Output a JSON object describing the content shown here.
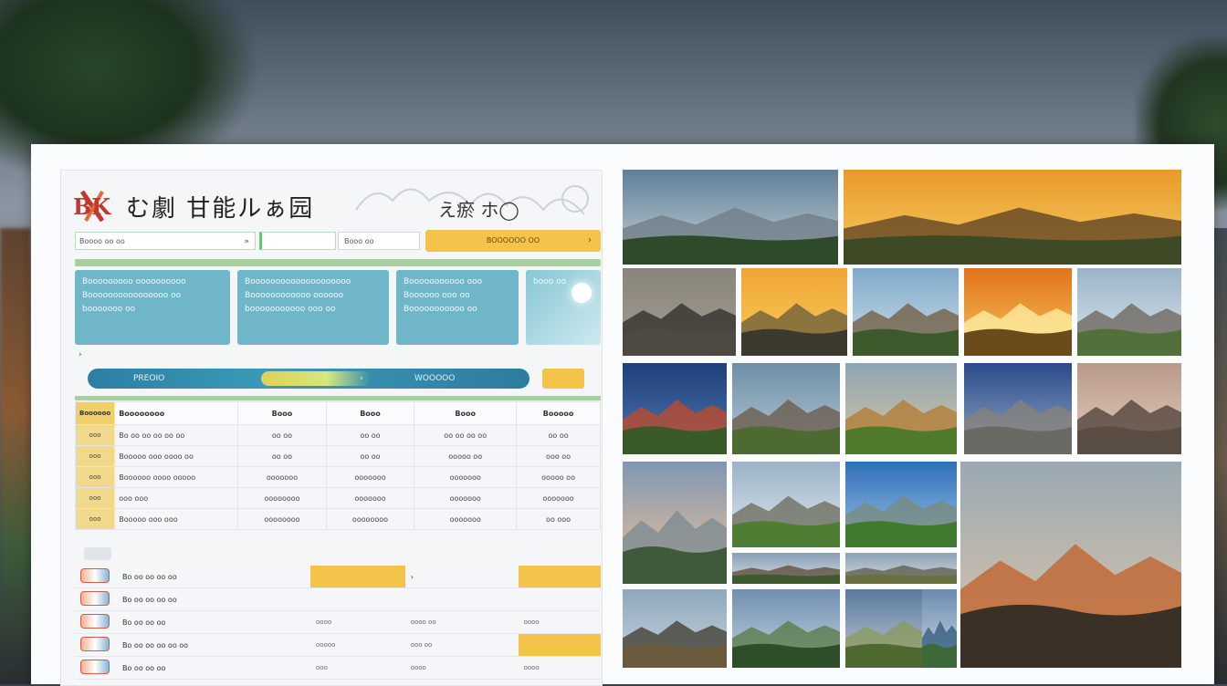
{
  "app": {
    "logo_text": "BK",
    "title": "む劇 甘能ルぁ园",
    "title_ext": "え瘀 ホ◯"
  },
  "search": {
    "placeholder": "Boooo oo oo",
    "arrow": "»"
  },
  "field3": {
    "text": "Booo oo"
  },
  "cta": {
    "label": "BOOOOOO OO",
    "arrow": "›"
  },
  "cards": [
    {
      "lines": [
        "Booooooooo oooooooooo",
        "Boooooooooooooooo oo",
        "booooooo oo"
      ]
    },
    {
      "lines": [
        "Boooooooooooooooooooo",
        "Boooooooooooo oooooo",
        "booooooooooo ooo oo"
      ]
    },
    {
      "lines": [
        "Booooooooooo ooo",
        "Boooooo ooo oo",
        "Booooooooooo oo"
      ]
    },
    {
      "lines": [
        "",
        "",
        "booo oo"
      ]
    }
  ],
  "tick": "›",
  "banner": {
    "left": "PREOIO",
    "mid": "›",
    "right": "WOOOOO"
  },
  "table": {
    "header": [
      "Boooooo",
      "Boooooooo",
      "Booo",
      "Booo",
      "Booo",
      "Booooo"
    ],
    "rows": [
      [
        "ooo",
        "Bo oo oo oo oo oo",
        "oo oo",
        "oo oo",
        "oo oo oo oo",
        "oo oo"
      ],
      [
        "ooo",
        "Booooo ooo oooo oo",
        "oo oo",
        "oo oo",
        "ooooo oo",
        "ooo oo"
      ],
      [
        "ooo",
        "Boooooo oooo ooooo",
        "ooooooo",
        "ooooooo",
        "ooooooo",
        "ooooo oo"
      ],
      [
        "ooo",
        "ooo  ooo",
        "oooooooo",
        "ooooooo",
        "ooooooo",
        "ooooooo"
      ],
      [
        "ooo",
        "Booooo ooo  ooo",
        "oooooooo",
        "oooooooo",
        "ooooooo",
        "oo ooo"
      ]
    ]
  },
  "list": {
    "rows": [
      {
        "name": "Bo oo oo oo oo",
        "c2": "",
        "c3": "›",
        "c4": ""
      },
      {
        "name": "Bo oo oo oo oo",
        "c2": "",
        "c3": "",
        "c4": ""
      },
      {
        "name": "Bo oo oo oo",
        "c2": "oooo",
        "c3": "oooo oo",
        "c4": "oooo"
      },
      {
        "name": "Bo oo oo oo oo oo",
        "c2": "ooooo",
        "c3": "ooo oo",
        "c4": ""
      },
      {
        "name": "Bo oo oo oo",
        "c2": "ooo",
        "c3": "oooo",
        "c4": "oooo"
      }
    ]
  },
  "gallery": [
    {
      "name": "mountain-forest-photo",
      "sky": "#5f7f98",
      "sky2": "#c9d2d6",
      "land": "#2e4a2a",
      "accent": "#6e7b83"
    },
    {
      "name": "temple-sunset-photo",
      "sky": "#e89a2a",
      "sky2": "#f6cc62",
      "land": "#3d4a25",
      "accent": "#5a3e22"
    },
    {
      "name": "stone-temple-photo",
      "sky": "#8a857c",
      "sky2": "#a39d90",
      "land": "#4e4a42",
      "accent": "#2e2b27"
    },
    {
      "name": "golden-clouds-photo",
      "sky": "#f0a436",
      "sky2": "#f8cf5a",
      "land": "#3b3a2c",
      "accent": "#6a5a3a"
    },
    {
      "name": "big-tree-photo",
      "sky": "#7fa9c9",
      "sky2": "#cfe0ea",
      "land": "#3e5a2c",
      "accent": "#6f5a3d"
    },
    {
      "name": "sun-hill-photo",
      "sky": "#e0731c",
      "sky2": "#f9c35a",
      "land": "#6b4a1c",
      "accent": "#fff1a8"
    },
    {
      "name": "domed-ruins-photo",
      "sky": "#9ab4c8",
      "sky2": "#dde6ea",
      "land": "#52703a",
      "accent": "#6a6258"
    },
    {
      "name": "pagoda-night-photo",
      "sky": "#1e3f7a",
      "sky2": "#4f78b0",
      "land": "#3a5a2a",
      "accent": "#c34a24"
    },
    {
      "name": "castle-tower-photo",
      "sky": "#6d8fa6",
      "sky2": "#b8cad6",
      "land": "#4d6a32",
      "accent": "#6a584a"
    },
    {
      "name": "golden-spires-photo",
      "sky": "#8ea3b4",
      "sky2": "#d8c8a0",
      "land": "#4f7a2c",
      "accent": "#b07a30"
    },
    {
      "name": "gothic-town-photo",
      "sky": "#2a4a8a",
      "sky2": "#93a9c6",
      "land": "#6a6a64",
      "accent": "#8a8278"
    },
    {
      "name": "cathedral-dusk-photo",
      "sky": "#b89a8a",
      "sky2": "#e6cdbb",
      "land": "#5a4e44",
      "accent": "#4a3e36"
    },
    {
      "name": "valley-sunset-photo",
      "sky": "#7f97b2",
      "sky2": "#f1c49a",
      "land": "#3e5a3a",
      "accent": "#7a8a92"
    },
    {
      "name": "cliff-meadow-photo",
      "sky": "#9bb3c8",
      "sky2": "#dfe7ec",
      "land": "#4f7d34",
      "accent": "#6a6a5a"
    },
    {
      "name": "green-mountains-photo",
      "sky": "#2f6fb8",
      "sky2": "#9cc3e4",
      "land": "#3f7a2e",
      "accent": "#7a8a7a"
    },
    {
      "name": "lake-pagoda-photo",
      "sky": "#9aa9b4",
      "sky2": "#e0c7a8",
      "land": "#3a3026",
      "accent": "#c0602a"
    },
    {
      "name": "terraced-ridge-photo",
      "sky": "#88a0b4",
      "sky2": "#d6dee4",
      "land": "#3e5a2e",
      "accent": "#5a4a34"
    },
    {
      "name": "dry-plateau-photo",
      "sky": "#8ca2b6",
      "sky2": "#d8dcda",
      "land": "#6a7040",
      "accent": "#5a5a4a"
    },
    {
      "name": "stone-stairs-photo",
      "sky": "#8fa8bc",
      "sky2": "#c7d3dc",
      "land": "#6a5a3e",
      "accent": "#3e3a2c"
    },
    {
      "name": "hill-forest-photo",
      "sky": "#6f8fb0",
      "sky2": "#c6d4de",
      "land": "#2e4e2a",
      "accent": "#557a44"
    },
    {
      "name": "marsh-trees-photo",
      "sky": "#5a7aa0",
      "sky2": "#c2ccd2",
      "land": "#4e6a30",
      "accent": "#8a9a5a"
    },
    {
      "name": "sea-coast-photo",
      "sky": "#6a8ab0",
      "sky2": "#d4dde4",
      "land": "#3e6a3a",
      "accent": "#2e5a7a"
    }
  ]
}
